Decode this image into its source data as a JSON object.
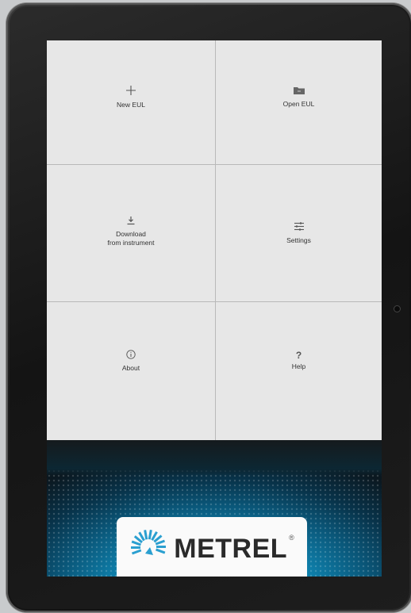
{
  "menu": {
    "new_eul": "New EUL",
    "open_eul": "Open EUL",
    "download_line1": "Download",
    "download_line2": "from instrument",
    "settings": "Settings",
    "about": "About",
    "help": "Help"
  },
  "icons": {
    "new_eul": "plus-icon",
    "open_eul": "folder-icon",
    "download": "download-icon",
    "settings": "sliders-icon",
    "about": "info-icon",
    "help": "question-icon"
  },
  "brand": {
    "logo_text": "METREL",
    "registered": "®",
    "accent": "#1aa9d6"
  },
  "help_glyph": "?"
}
